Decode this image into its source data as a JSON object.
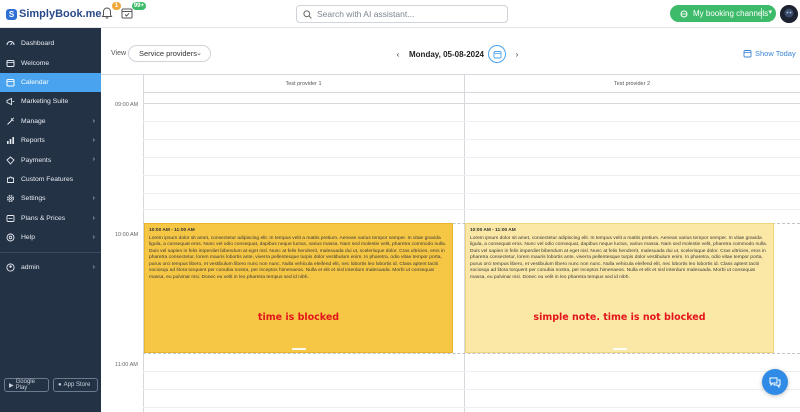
{
  "brand": {
    "logo_text": "SimplyBook.me"
  },
  "topbar": {
    "notifications_count": "1",
    "tasks_count": "99+",
    "search_placeholder": "Search with AI assistant...",
    "booking_channels_label": "My booking channels"
  },
  "sidebar": {
    "items": [
      {
        "label": "Dashboard",
        "icon": "dashboard-icon"
      },
      {
        "label": "Welcome",
        "icon": "welcome-icon"
      },
      {
        "label": "Calendar",
        "icon": "calendar-icon",
        "active": true
      },
      {
        "label": "Marketing Suite",
        "icon": "marketing-icon"
      },
      {
        "label": "Manage",
        "icon": "manage-icon"
      },
      {
        "label": "Reports",
        "icon": "reports-icon"
      },
      {
        "label": "Payments",
        "icon": "payments-icon"
      },
      {
        "label": "Custom Features",
        "icon": "puzzle-icon"
      },
      {
        "label": "Settings",
        "icon": "gear-icon"
      },
      {
        "label": "Plans & Prices",
        "icon": "plans-icon"
      },
      {
        "label": "Help",
        "icon": "help-icon"
      }
    ],
    "user_label": "admin",
    "google_play_label": "Google Play",
    "app_store_label": "App Store"
  },
  "toolbar": {
    "view_label": "View",
    "view_select_value": "Service providers",
    "date_label": "Monday, 05-08-2024",
    "show_today_label": "Show Today"
  },
  "calendar": {
    "providers": [
      "Test provider 1",
      "Test provider 2"
    ],
    "time_labels": [
      "09:00 AM",
      "10:00 AM",
      "11:00 AM"
    ],
    "events": [
      {
        "time": "10:00 AM - 11:00 AM",
        "description": "Lorem ipsum dolor sit amet, consectetur adipiscing elit. In tempus velit a mattis pretium. Aenean varius tempor semper. In vitae gravida ligula, a consequat eros. Nunc vel odio consequat, dapibus neque luctus, varius massa. Nam sed molestie velit, pharetra commodo nulla. Duis vel sapien in felis imperdiet bibendum at eget nisl. Nunc at felis hendrerit, malesuada dui ut, scelerisque dolor. Cras ultricies, eros in pharetra consectetur, lorem mauris lobortis ante, viverra pellentesque turpis dolor vestibulum enim. In pharetra, odio vitae tempor porta, purus orci tempus libero, et vestibulum libero nunc non nunc. Nulla vehicula eleifend elit, nec lobortis leo lobortis id. Class aptent taciti sociosqu ad litora torquent per conubia nostra, per inceptos himenaeos. Nulla et elit et nisl interdum malesuada. Morbi ut consequat massa, eu pulvinar nisi. Donec eu velit in leo pharetra tempus sed id nibh.",
        "label": "time is blocked",
        "color": "#f6c744"
      },
      {
        "time": "10:00 AM - 11:00 AM",
        "description": "Lorem ipsum dolor sit amet, consectetur adipiscing elit. In tempus velit a mattis pretium. Aenean varius tempor semper. In vitae gravida ligula, a consequat eros. Nunc vel odio consequat, dapibus neque luctus, varius massa. Nam sed molestie velit, pharetra commodo nulla. Duis vel sapien in felis imperdiet bibendum at eget nisl. Nunc at felis hendrerit, malesuada dui ut, scelerisque dolor. Cras ultricies, eros in pharetra consectetur, lorem mauris lobortis ante, viverra pellentesque turpis dolor vestibulum enim. In pharetra, odio vitae tempor porta, purus orci tempus libero, et vestibulum libero nunc non nunc. Nulla vehicula eleifend elit, nec lobortis leo lobortis id. Class aptent taciti sociosqu ad litora torquent per conubia nostra, per inceptos himenaeos. Nulla et elit et nisl interdum malesuada. Morbi ut consequat massa, eu pulvinar nisi. Donec eu velit in leo pharetra tempus sed id nibh.",
        "label": "simple note. time is not blocked",
        "color": "#fbe8a6"
      }
    ]
  },
  "colors": {
    "sidebar_bg": "#243246",
    "active_nav": "#4aa3ee",
    "primary_green": "#3dbb6a",
    "blocked_event": "#f6c744",
    "note_event": "#fbe8a6",
    "label_red": "#e4141b"
  }
}
